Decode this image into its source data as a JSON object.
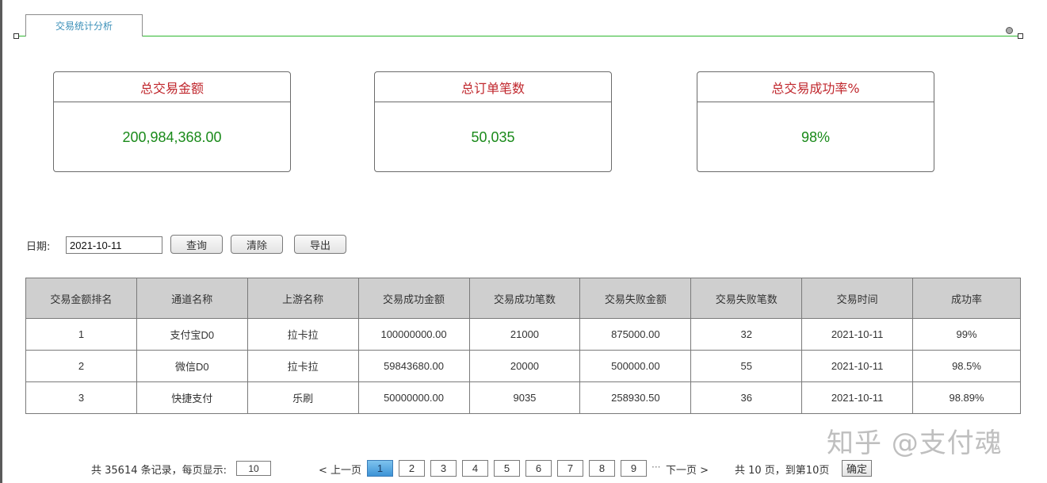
{
  "tab": {
    "label": "交易统计分析"
  },
  "stats": [
    {
      "title": "总交易金额",
      "value": "200,984,368.00"
    },
    {
      "title": "总订单笔数",
      "value": "50,035"
    },
    {
      "title": "总交易成功率%",
      "value": "98%"
    }
  ],
  "filter": {
    "date_label": "日期:",
    "date_value": "2021-10-11",
    "query_label": "查询",
    "clear_label": "清除",
    "export_label": "导出"
  },
  "table": {
    "headers": [
      "交易金额排名",
      "通道名称",
      "上游名称",
      "交易成功金额",
      "交易成功笔数",
      "交易失败金额",
      "交易失败笔数",
      "交易时间",
      "成功率"
    ],
    "rows": [
      [
        "1",
        "支付宝D0",
        "拉卡拉",
        "100000000.00",
        "21000",
        "875000.00",
        "32",
        "2021-10-11",
        "99%"
      ],
      [
        "2",
        "微信D0",
        "拉卡拉",
        "59843680.00",
        "20000",
        "500000.00",
        "55",
        "2021-10-11",
        "98.5%"
      ],
      [
        "3",
        "快捷支付",
        "乐刷",
        "50000000.00",
        "9035",
        "258930.50",
        "36",
        "2021-10-11",
        "98.89%"
      ]
    ]
  },
  "pager": {
    "info": "共 35614 条记录，每页显示:",
    "per_page": "10",
    "prev": "< 上一页",
    "pages": [
      "1",
      "2",
      "3",
      "4",
      "5",
      "6",
      "7",
      "8",
      "9"
    ],
    "current_page": "1",
    "ellipsis": "···",
    "next": "下一页 >",
    "total": "共 10 页，到第10页",
    "confirm": "确定"
  },
  "watermark": "知乎 @支付魂"
}
